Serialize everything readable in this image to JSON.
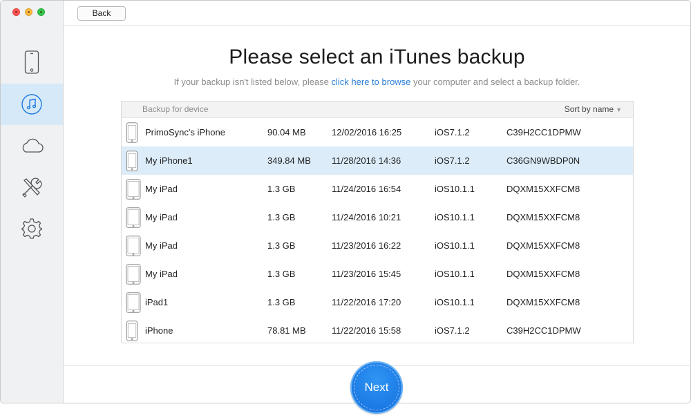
{
  "toolbar": {
    "back_label": "Back"
  },
  "main": {
    "title": "Please select an iTunes backup",
    "subtitle_before": "If your backup isn't listed below, please",
    "subtitle_link": "click here to browse",
    "subtitle_after": "your computer and select a backup folder."
  },
  "sidebar": {
    "items": [
      {
        "icon": "iphone-icon",
        "active": false
      },
      {
        "icon": "music-note-icon",
        "active": true
      },
      {
        "icon": "cloud-icon",
        "active": false
      },
      {
        "icon": "tools-icon",
        "active": false
      },
      {
        "icon": "gear-icon",
        "active": false
      }
    ]
  },
  "table": {
    "header": "Backup for device",
    "sort_label": "Sort by name",
    "rows": [
      {
        "device_icon": "iphone-icon",
        "name": "PrimoSync's iPhone",
        "size": "90.04 MB",
        "date": "12/02/2016 16:25",
        "ios": "iOS7.1.2",
        "serial": "C39H2CC1DPMW",
        "selected": false
      },
      {
        "device_icon": "iphone-icon",
        "name": "My iPhone1",
        "size": "349.84 MB",
        "date": "11/28/2016 14:36",
        "ios": "iOS7.1.2",
        "serial": "C36GN9WBDP0N",
        "selected": true
      },
      {
        "device_icon": "ipad-icon",
        "name": "My iPad",
        "size": "1.3 GB",
        "date": "11/24/2016 16:54",
        "ios": "iOS10.1.1",
        "serial": "DQXM15XXFCM8",
        "selected": false
      },
      {
        "device_icon": "ipad-icon",
        "name": "My iPad",
        "size": "1.3 GB",
        "date": "11/24/2016 10:21",
        "ios": "iOS10.1.1",
        "serial": "DQXM15XXFCM8",
        "selected": false
      },
      {
        "device_icon": "ipad-icon",
        "name": "My iPad",
        "size": "1.3 GB",
        "date": "11/23/2016 16:22",
        "ios": "iOS10.1.1",
        "serial": "DQXM15XXFCM8",
        "selected": false
      },
      {
        "device_icon": "ipad-icon",
        "name": "My iPad",
        "size": "1.3 GB",
        "date": "11/23/2016 15:45",
        "ios": "iOS10.1.1",
        "serial": "DQXM15XXFCM8",
        "selected": false
      },
      {
        "device_icon": "ipad-icon",
        "name": "iPad1",
        "size": "1.3 GB",
        "date": "11/22/2016 17:20",
        "ios": "iOS10.1.1",
        "serial": "DQXM15XXFCM8",
        "selected": false
      },
      {
        "device_icon": "iphone-icon",
        "name": "iPhone",
        "size": "78.81 MB",
        "date": "11/22/2016 15:58",
        "ios": "iOS7.1.2",
        "serial": "C39H2CC1DPMW",
        "selected": false
      }
    ]
  },
  "footer": {
    "next_label": "Next"
  },
  "colors": {
    "accent": "#1a78e3",
    "selected_row": "#dcecf9",
    "link": "#2a7ed8"
  }
}
